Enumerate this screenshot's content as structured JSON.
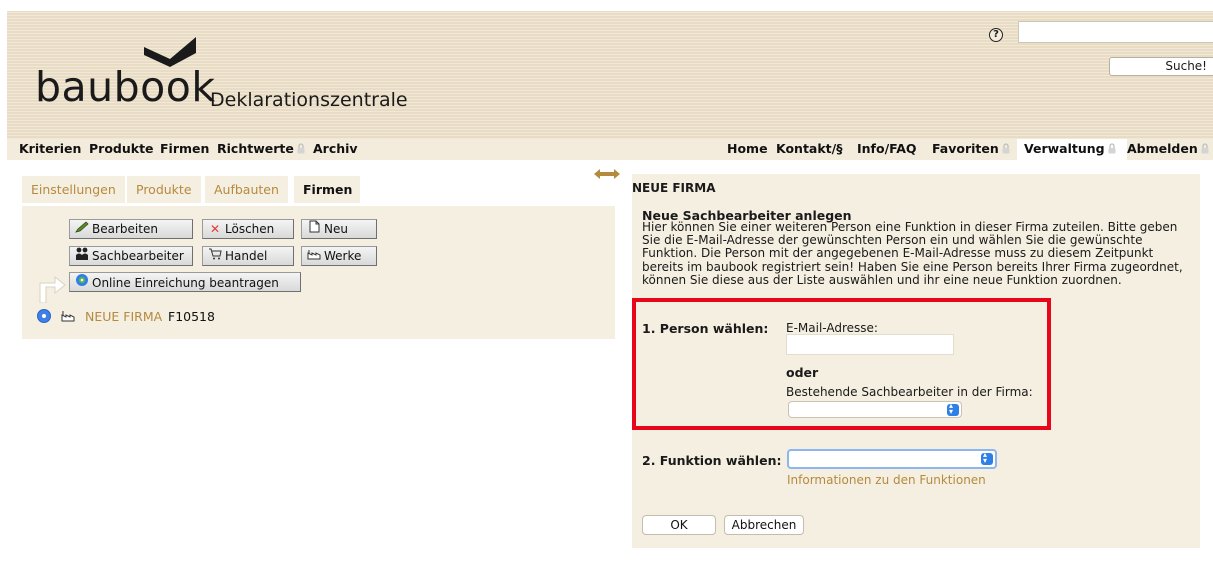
{
  "header": {
    "logo_text": "baubook",
    "subtitle": "Deklarationszentrale",
    "help_glyph": "?",
    "search_placeholder": "",
    "search_button_label": "Suche!"
  },
  "nav": {
    "left": [
      {
        "label": "Kriterien"
      },
      {
        "label": "Produkte"
      },
      {
        "label": "Firmen"
      },
      {
        "label": "Richtwerte"
      },
      {
        "label": "Archiv"
      }
    ],
    "right": [
      {
        "label": "Home"
      },
      {
        "label": "Kontakt/§"
      },
      {
        "label": "Info/FAQ"
      },
      {
        "label": "Favoriten"
      },
      {
        "label": "Verwaltung"
      },
      {
        "label": "Abmelden"
      }
    ]
  },
  "left_panel": {
    "tabs": [
      {
        "label": "Einstellungen",
        "active": false
      },
      {
        "label": "Produkte",
        "active": false
      },
      {
        "label": "Aufbauten",
        "active": false
      },
      {
        "label": "Firmen",
        "active": true
      }
    ],
    "buttons": {
      "edit": "Bearbeiten",
      "delete": "Löschen",
      "new": "Neu",
      "staff": "Sachbearbeiter",
      "trade": "Handel",
      "plants": "Werke",
      "online": "Online Einreichung beantragen"
    },
    "tree": {
      "company_name": "NEUE FIRMA",
      "company_id": "F10518"
    }
  },
  "right_panel": {
    "title": "NEUE FIRMA",
    "subtitle": "Neue Sachbearbeiter anlegen",
    "description": "Hier können Sie einer weiteren Person eine Funktion in dieser Firma zuteilen. Bitte geben Sie die E-Mail-Adresse der gewünschten Person ein und wählen Sie die gewünschte Funktion. Die Person mit der angegebenen E-Mail-Adresse muss zu diesem Zeitpunkt bereits im baubook registriert sein! Haben Sie eine Person bereits Ihrer Firma zugeordnet, können Sie diese aus der Liste auswählen und ihr eine neue Funktion zuordnen.",
    "step1_label": "1. Person wählen:",
    "email_label": "E-Mail-Adresse:",
    "email_value": "",
    "or_label": "oder",
    "existing_label": "Bestehende Sachbearbeiter in der Firma:",
    "existing_selected": "",
    "step2_label": "2. Funktion wählen:",
    "function_selected": "",
    "info_link": "Informationen zu den Funktionen",
    "ok_label": "OK",
    "cancel_label": "Abbrechen"
  },
  "colors": {
    "header_bg": "#e9dcc4",
    "panel_bg": "#f5efe2",
    "link": "#b58a3e",
    "highlight": "#e8061a",
    "select_accent": "#2f7fe8"
  }
}
